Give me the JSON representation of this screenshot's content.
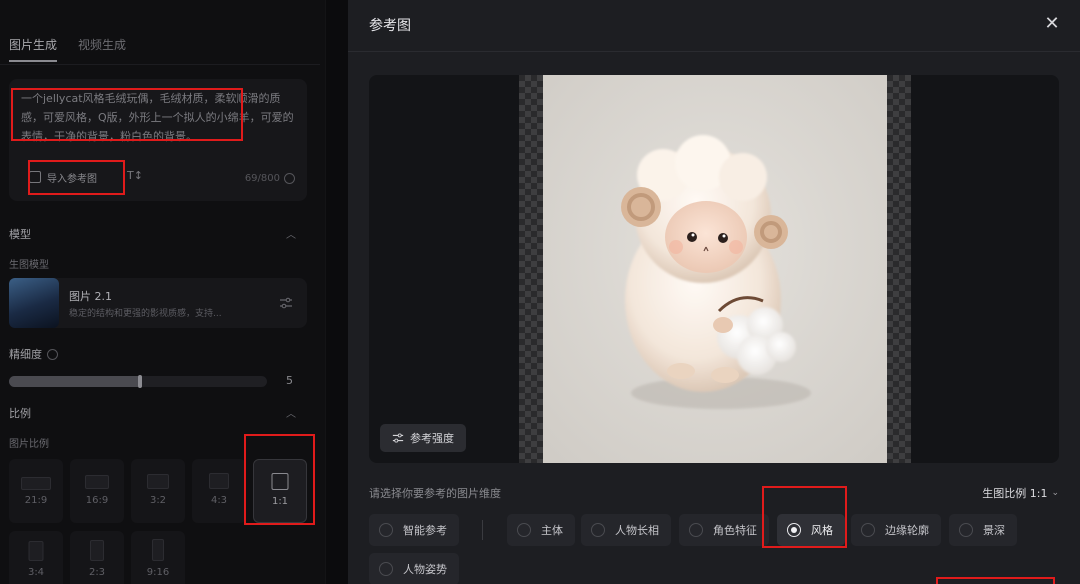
{
  "left_panel": {
    "tabs": [
      {
        "label": "图片生成",
        "active": true
      },
      {
        "label": "视频生成",
        "active": false
      }
    ],
    "prompt": {
      "text": "一个jellycat风格毛绒玩偶，毛绒材质，柔软顺滑的质感，可爱风格，Q版，外形上一个拟人的小绵羊，可爱的表情，干净的背景，粉白色的背景。",
      "import_label": "导入参考图",
      "counter": "69/800"
    },
    "model_section": {
      "title": "模型",
      "sub_label": "生图模型",
      "model_name": "图片 2.1",
      "model_desc": "稳定的结构和更强的影视质感，支持..."
    },
    "detail": {
      "label": "精细度",
      "value": "5",
      "level_fraction": 0.5
    },
    "ratio_section": {
      "title": "比例",
      "sub_label": "图片比例",
      "options": [
        {
          "label": "21:9"
        },
        {
          "label": "16:9"
        },
        {
          "label": "3:2"
        },
        {
          "label": "4:3"
        },
        {
          "label": "1:1",
          "active": true
        },
        {
          "label": "3:4"
        },
        {
          "label": "2:3"
        },
        {
          "label": "9:16"
        }
      ]
    }
  },
  "modal": {
    "title": "参考图",
    "close_icon": "close-icon",
    "strength_button": "参考强度",
    "dimension_label": "请选择你要参考的图片维度",
    "ratio_select": "生图比例 1:1",
    "options": [
      {
        "label": "智能参考",
        "selected": false
      },
      {
        "label": "主体",
        "selected": false
      },
      {
        "label": "人物长相",
        "selected": false
      },
      {
        "label": "角色特征",
        "selected": false
      },
      {
        "label": "风格",
        "selected": true
      },
      {
        "label": "边缘轮廓",
        "selected": false
      },
      {
        "label": "景深",
        "selected": false
      },
      {
        "label": "人物姿势",
        "selected": false
      }
    ]
  },
  "colors": {
    "annotation": "#e01b1b",
    "modal_bg": "#1d1e22",
    "photo_bg": "#d9d6d1"
  }
}
